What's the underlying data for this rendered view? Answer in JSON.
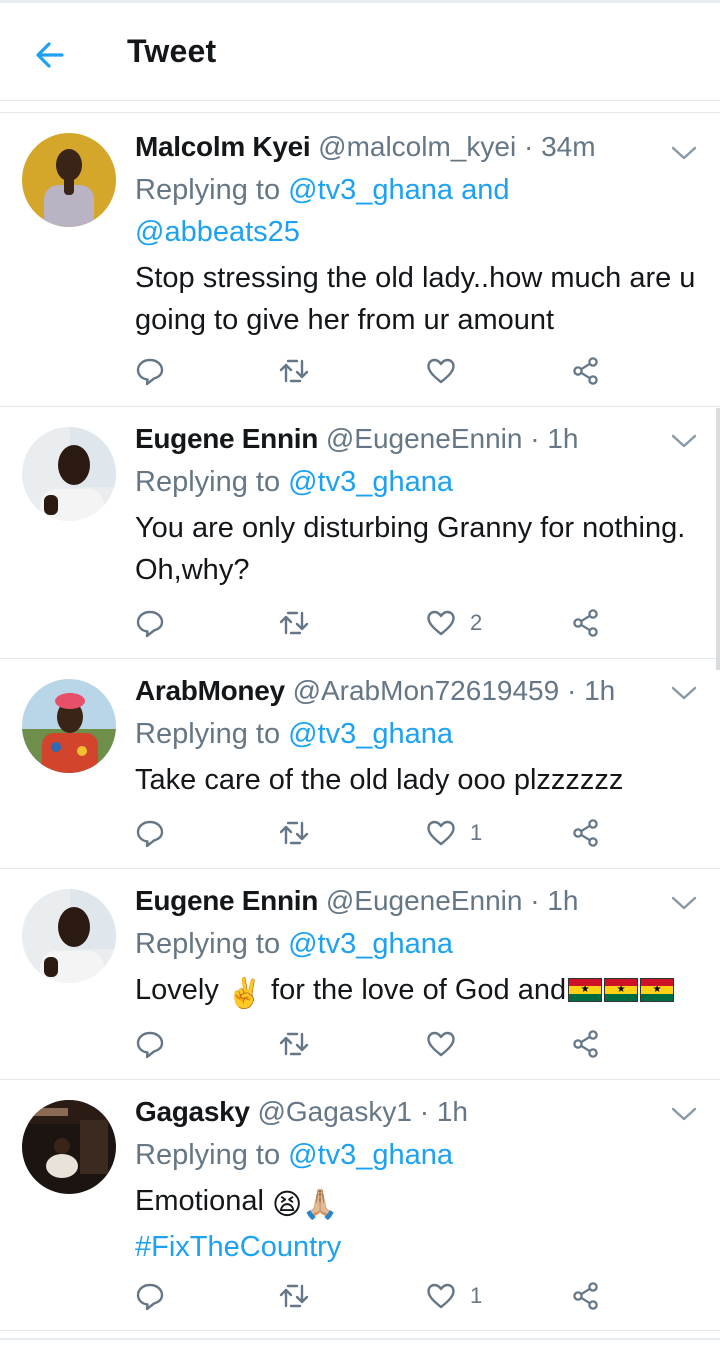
{
  "header": {
    "title": "Tweet"
  },
  "tweets": [
    {
      "name": "Malcolm Kyei",
      "handle": "@malcolm_kyei",
      "time": "34m",
      "replying_prefix": "Replying to ",
      "mention1": "@tv3_ghana",
      "and": " and",
      "mention2": "@abbeats25",
      "text": "Stop stressing the old lady..how much are u going to give her from ur amount",
      "likes": ""
    },
    {
      "name": "Eugene Ennin",
      "handle": "@EugeneEnnin",
      "time": "1h",
      "replying_prefix": "Replying to ",
      "mention1": "@tv3_ghana",
      "text": "You are only disturbing Granny for nothing. Oh,why?",
      "likes": "2"
    },
    {
      "name": "ArabMoney",
      "handle": "@ArabMon72619459",
      "time": "1h",
      "replying_prefix": "Replying to ",
      "mention1": "@tv3_ghana",
      "text": "Take care of the old lady ooo plzzzzzz",
      "likes": "1"
    },
    {
      "name": "Eugene Ennin",
      "handle": "@EugeneEnnin",
      "time": "1h",
      "replying_prefix": "Replying to ",
      "mention1": "@tv3_ghana",
      "text_a": "Lovely ",
      "emoji_a": "✌️",
      "text_b": " for the love of God and",
      "likes": ""
    },
    {
      "name": "Gagasky",
      "handle": "@Gagasky1",
      "time": "1h",
      "replying_prefix": "Replying to ",
      "mention1": "@tv3_ghana",
      "text_a": "Emotional ",
      "emoji_a": "😫",
      "emoji_b": "🙏🏼",
      "hashtag": "#FixTheCountry",
      "likes": "1"
    }
  ],
  "dot": " · ",
  "flag_star": "★",
  "colors": {
    "accent": "#1da1f2",
    "muted": "#657786",
    "text": "#14171a",
    "divider": "#e1e8ed"
  },
  "icons": [
    "back-arrow-icon",
    "chevron-down-icon",
    "reply-icon",
    "retweet-icon",
    "like-icon",
    "share-icon"
  ]
}
